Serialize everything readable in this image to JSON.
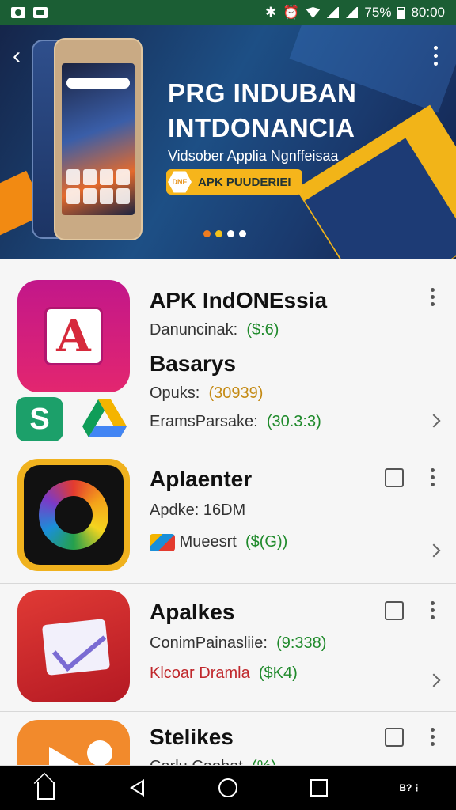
{
  "status_bar": {
    "battery": "75%",
    "time": "80:00"
  },
  "banner": {
    "title_line1": "PRG INDUBAN",
    "title_line2": "INTDONANCIA",
    "subtitle": "Vidsober Applia Ngnffeisaa",
    "badge_icon_text": "DNE",
    "badge_label": "APK PUUDERIEI",
    "carousel_pages": 4,
    "carousel_active": 1,
    "colors": {
      "accent_yellow": "#f6b51b",
      "accent_orange": "#ef7c1f",
      "bg": "#1d4f85"
    }
  },
  "apps": [
    {
      "name": "APK IndONEssia",
      "lines": [
        {
          "label": "Danuncinak:",
          "value": "($:6)"
        },
        {
          "label": "Opuks:",
          "value": "(30939)"
        },
        {
          "label": "EramsParsake:",
          "value": "(30.3:3)"
        }
      ],
      "secondary_name": "Basarys",
      "icon": "app-a-icon",
      "sub_icons": [
        "s-app-icon",
        "drive-icon"
      ]
    },
    {
      "name": "Aplaenter",
      "lines": [
        {
          "label": "Apdke: 16DM",
          "value": ""
        },
        {
          "label": "Mueesrt",
          "value": "($(G))"
        }
      ],
      "icon": "ring-icon",
      "checkbox": false
    },
    {
      "name": "Apalkes",
      "lines": [
        {
          "label": "ConimPainasliie:",
          "value": "(9:338)"
        },
        {
          "label": "Klcoar Dramla",
          "value": "($K4)"
        }
      ],
      "icon": "checkmark-doc-icon",
      "checkbox": false
    },
    {
      "name": "Stelikes",
      "lines": [
        {
          "label": "Carlu Caobat",
          "value": "(%)"
        }
      ],
      "icon": "play-chat-icon",
      "checkbox": false
    }
  ],
  "nav_bar": {
    "extra_label_top": "B?",
    "extra_label_bottom": "⋮"
  }
}
